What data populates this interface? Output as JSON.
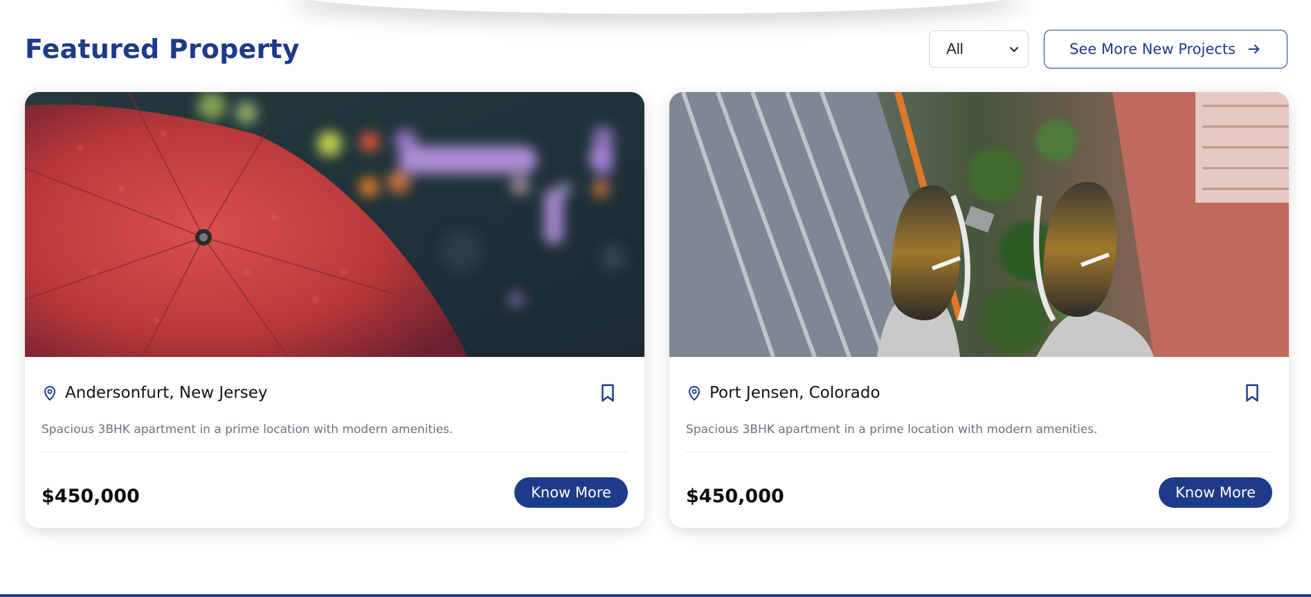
{
  "header": {
    "title": "Featured Property",
    "filter_selected": "All",
    "see_more_label": "See More New Projects"
  },
  "colors": {
    "brand": "#1e3a8a",
    "muted_text": "#6b7280",
    "divider": "#e5e7eb"
  },
  "cards": [
    {
      "location": "Andersonfurt, New Jersey",
      "description": "Spacious 3BHK apartment in a prime location with modern amenities.",
      "price": "$450,000",
      "button_label": "Know More",
      "image": "red-umbrella-photo"
    },
    {
      "location": "Port Jensen, Colorado",
      "description": "Spacious 3BHK apartment in a prime location with modern amenities.",
      "price": "$450,000",
      "button_label": "Know More",
      "image": "skyscraper-feet-photo"
    }
  ]
}
